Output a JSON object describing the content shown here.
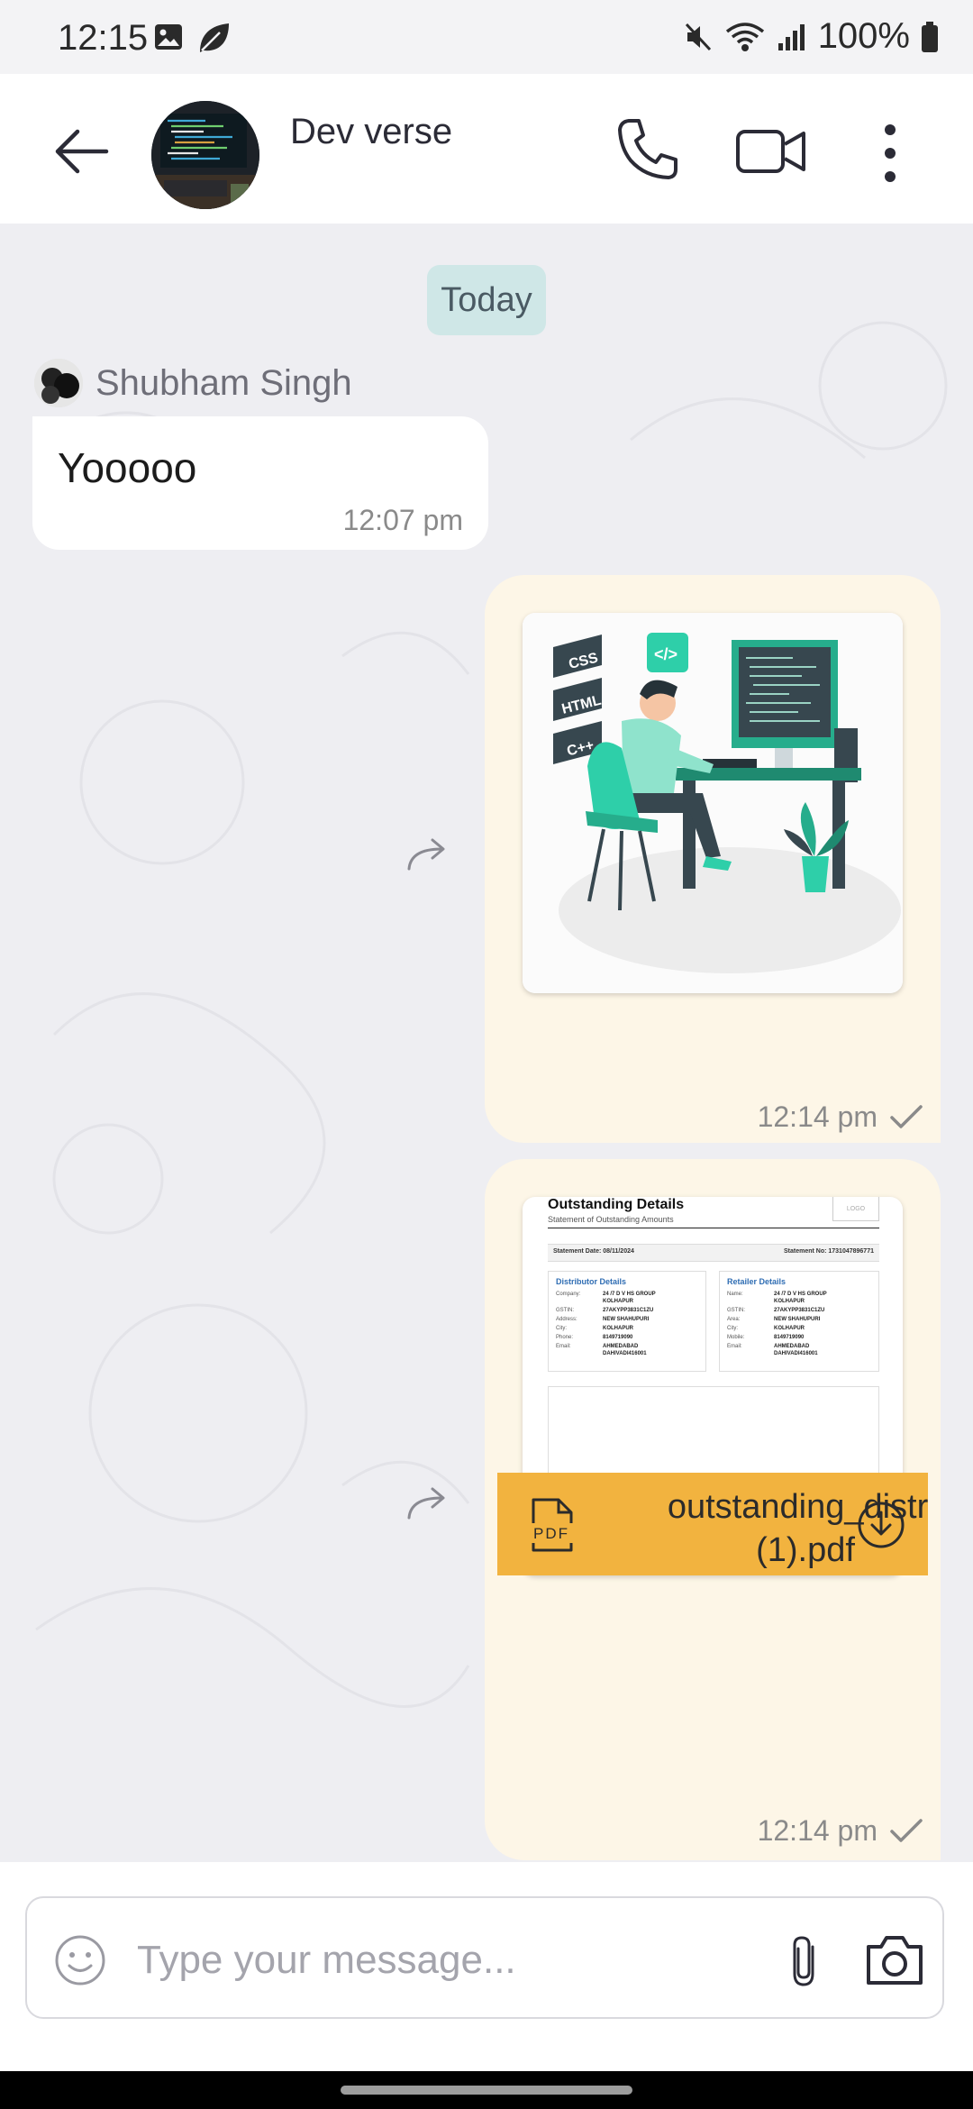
{
  "status_bar": {
    "time": "12:15",
    "left_icons": [
      "image-icon",
      "leaf-icon"
    ],
    "right_icons": [
      "mute-icon",
      "wifi-icon",
      "signal-icon",
      "battery-icon"
    ],
    "battery": "100%"
  },
  "header": {
    "title": "Dev verse",
    "icons": [
      "back-arrow-icon",
      "phone-icon",
      "video-camera-icon",
      "more-vertical-icon"
    ]
  },
  "chat": {
    "date_label": "Today",
    "messages": [
      {
        "direction": "incoming",
        "sender": "Shubham Singh",
        "text": "Yooooo",
        "time": "12:07 pm"
      },
      {
        "direction": "outgoing",
        "type": "image",
        "image_labels": [
          "CSS",
          "HTML",
          "C++"
        ],
        "time": "12:14 pm",
        "status": "sent"
      },
      {
        "direction": "outgoing",
        "type": "pdf",
        "preview": {
          "title": "Outstanding Details",
          "subtitle": "Statement of Outstanding Amounts",
          "logo": "LOGO",
          "statement_date": "Statement Date: 08/11/2024",
          "statement_no": "Statement No: 1731047896771",
          "distributor": {
            "heading": "Distributor Details",
            "rows": [
              [
                "Company:",
                "24 /7 D V HS GROUP"
              ],
              [
                "",
                "KOLHAPUR"
              ],
              [
                "GSTIN:",
                "27AKYPP3831C1ZU"
              ],
              [
                "Address:",
                "NEW SHAHUPURI"
              ],
              [
                "City:",
                "KOLHAPUR"
              ],
              [
                "Phone:",
                "8149719090"
              ],
              [
                "Email:",
                "AHMEDABAD"
              ],
              [
                "",
                "DAHIVADI416001"
              ]
            ]
          },
          "retailer": {
            "heading": "Retailer Details",
            "rows": [
              [
                "Name:",
                "24 /7 D V HS GROUP"
              ],
              [
                "",
                "KOLHAPUR"
              ],
              [
                "GSTIN:",
                "27AKYPP3831C1ZU"
              ],
              [
                "Area:",
                "NEW SHAHUPURI"
              ],
              [
                "City:",
                "KOLHAPUR"
              ],
              [
                "Mobile:",
                "8149719090"
              ],
              [
                "Email:",
                "AHMEDABAD"
              ],
              [
                "",
                "DAHIVADI416001"
              ]
            ]
          }
        },
        "file_badge": "PDF",
        "file_name_line1": "outstanding_distril",
        "file_name_line2": "(1).pdf",
        "time": "12:14 pm",
        "status": "sent"
      }
    ]
  },
  "composer": {
    "placeholder": "Type your message...",
    "icons": [
      "emoji-icon",
      "paperclip-icon",
      "camera-icon"
    ]
  },
  "colors": {
    "incoming_bubble": "#ffffff",
    "outgoing_bubble": "#fdf6e7",
    "date_pill": "#cfe7e7",
    "pdf_bar": "#f2b33f",
    "chat_background": "#eeeef2"
  }
}
